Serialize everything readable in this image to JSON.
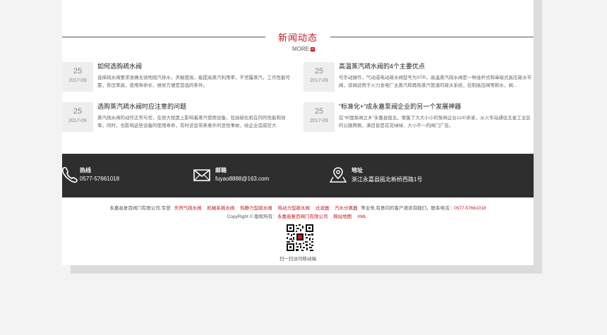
{
  "section": {
    "title": "新闻动态",
    "more_label": "MORE"
  },
  "news": [
    {
      "day": "25",
      "ym": "2017-09",
      "title": "如何选购疏水阀",
      "desc": "选择疏水阀要求准确无误地阻汽排水，灵敏度高，能提高蒸汽利用率，不泄露蒸汽，工作性能可靠，背压率高，使用寿命长，维修方便是首选的条件。"
    },
    {
      "day": "25",
      "ym": "2017-09",
      "title": "高温蒸汽疏水阀的4个主要优点",
      "desc": "可手动操作，气动或电动疏水阀型号为STR，高温蒸汽疏水阀是一种连杆式和串级式高压疏水节阀，该阀适用于火力发电厂主蒸汽和再热蒸汽管道的疏水系统，控制高压阀等和水，阀..."
    },
    {
      "day": "25",
      "ym": "2017-09",
      "title": "选购蒸汽疏水阀时应注意的问题",
      "desc": "蒸汽疏水阀的动作正常与否，在很大程度上影响着蒸汽使用设备，包括硫化机在内的性能和效率。同时，也影响这些设备的使用寿命，有时还会带来意外的恶性事故，给企业造成巨大"
    },
    {
      "day": "25",
      "ym": "2017-09",
      "title": "“标准化+”成永嘉泵阀企业的另一个发展神器",
      "desc": "在“中国泵阀之乡”永嘉县瓯北，聚集了大大小小的泵阀企业1100多家，从火车站通往五星工业区的公路两侧，满目皆是花花绿绿、大小不一的阀门广告。"
    }
  ],
  "contact": {
    "phone_label": "热线",
    "phone": "0577-57661018",
    "email_label": "邮箱",
    "email": "fuyao8888@163.com",
    "address_label": "地址",
    "address": "浙江永嘉县瓯北新桥西路1号"
  },
  "footer": {
    "line1_prefix": "永嘉县复百阀门有限公司,专营",
    "links": [
      "天然气疏水阀",
      "机械系疏水阀",
      "热静力型疏水阀",
      "热动力型疏水阀",
      "过滤器",
      "汽水分离器"
    ],
    "line1_suffix": "等业务,有意向的客户请咨询我们，联系电话：",
    "line1_phone": "0577-57661018",
    "copyright": "CopyRight © 版权所有:",
    "company_link": "永嘉县复百阀门有限公司",
    "sitemap": "网站地图",
    "xml": "XML",
    "qr_caption": "扫一扫访问移动端"
  },
  "colors": {
    "accent": "#c4161c",
    "contact_bar": "#2e2e2e"
  }
}
